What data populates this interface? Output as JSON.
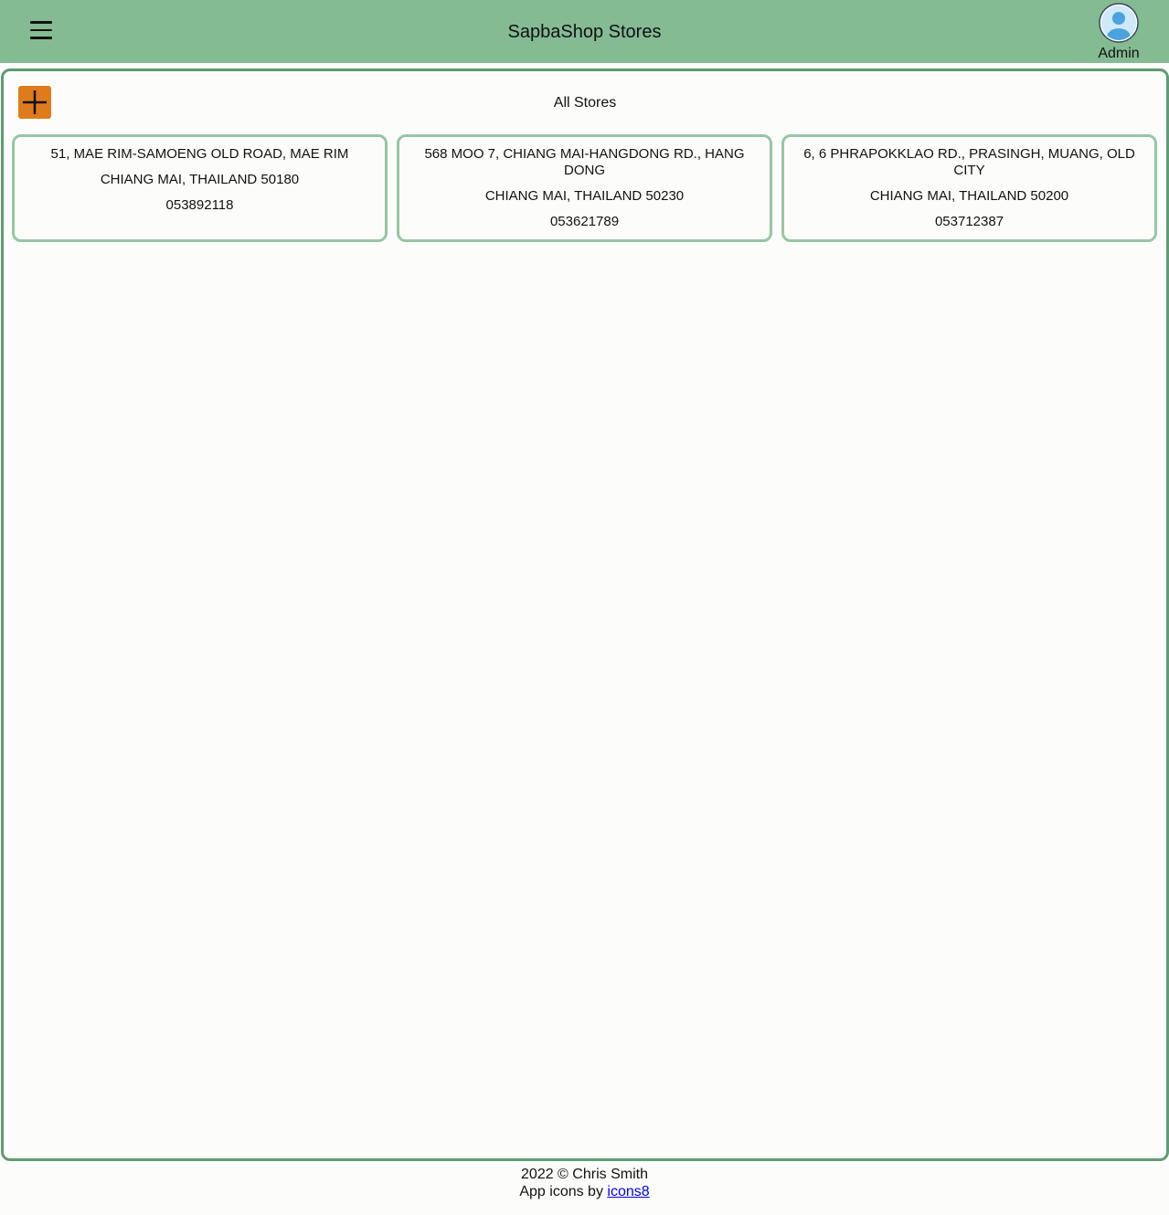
{
  "header": {
    "title": "SapbaShop Stores",
    "menu_icon": "hamburger-menu-icon",
    "user": {
      "avatar_icon": "user-avatar-icon",
      "name": "Admin"
    },
    "colors": {
      "header_bg": "#84bb93"
    }
  },
  "main": {
    "add_icon": "plus-icon",
    "section_title": "All Stores",
    "colors": {
      "panel_border": "#5f9c72",
      "card_border": "#97c6a3",
      "add_button": "#e07b1b"
    },
    "stores": [
      {
        "address": "51, MAE RIM-SAMOENG OLD ROAD, MAE RIM",
        "city_line": "CHIANG MAI, THAILAND 50180",
        "phone": "053892118"
      },
      {
        "address": "568 MOO 7, CHIANG MAI-HANGDONG RD., HANG DONG",
        "city_line": "CHIANG MAI, THAILAND 50230",
        "phone": "053621789"
      },
      {
        "address": "6, 6 PHRAPOKKLAO RD., PRASINGH, MUANG, OLD CITY",
        "city_line": "CHIANG MAI, THAILAND 50200",
        "phone": "053712387"
      }
    ]
  },
  "footer": {
    "copyright": "2022 © Chris Smith",
    "icons_prefix": "App icons by ",
    "icons_link": "icons8"
  }
}
